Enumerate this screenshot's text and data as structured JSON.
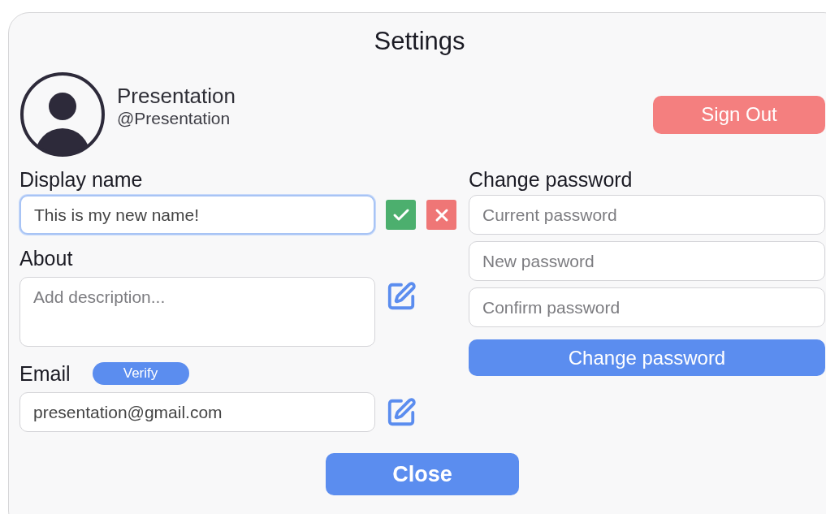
{
  "window": {
    "title": "Settings"
  },
  "profile": {
    "name": "Presentation",
    "handle": "@Presentation"
  },
  "sign_out": "Sign Out",
  "display_name": {
    "label": "Display name",
    "value": "This is my new name!",
    "focused": true
  },
  "about": {
    "label": "About",
    "placeholder": "Add description..."
  },
  "email": {
    "label": "Email",
    "verify": "Verify",
    "value": "presentation@gmail.com"
  },
  "password": {
    "label": "Change password",
    "fields": [
      {
        "placeholder": "Current password"
      },
      {
        "placeholder": "New password"
      },
      {
        "placeholder": "Confirm password"
      }
    ],
    "submit": "Change password"
  },
  "close": "Close"
}
